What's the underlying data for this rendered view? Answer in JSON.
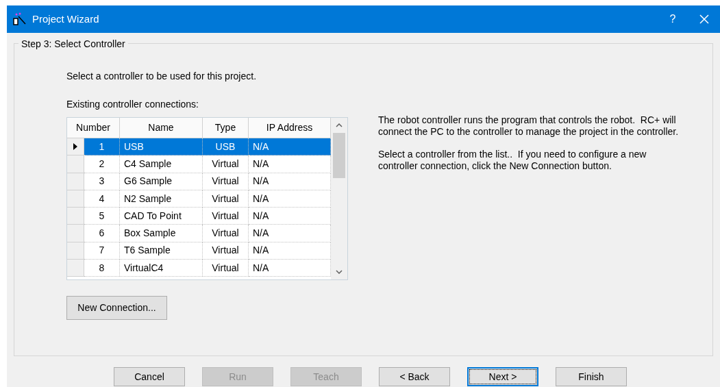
{
  "window": {
    "title": "Project Wizard",
    "help_glyph": "?"
  },
  "step": {
    "title": "Step 3: Select Controller"
  },
  "intro": "Select a controller to be used for this project.",
  "list_label": "Existing controller connections:",
  "table": {
    "columns": [
      "Number",
      "Name",
      "Type",
      "IP Address"
    ],
    "rows": [
      {
        "cells": [
          "1",
          "USB",
          "USB",
          "N/A"
        ],
        "selected": true
      },
      {
        "cells": [
          "2",
          "C4 Sample",
          "Virtual",
          "N/A"
        ],
        "selected": false
      },
      {
        "cells": [
          "3",
          "G6 Sample",
          "Virtual",
          "N/A"
        ],
        "selected": false
      },
      {
        "cells": [
          "4",
          "N2 Sample",
          "Virtual",
          "N/A"
        ],
        "selected": false
      },
      {
        "cells": [
          "5",
          "CAD To Point",
          "Virtual",
          "N/A"
        ],
        "selected": false
      },
      {
        "cells": [
          "6",
          "Box Sample",
          "Virtual",
          "N/A"
        ],
        "selected": false
      },
      {
        "cells": [
          "7",
          "T6 Sample",
          "Virtual",
          "N/A"
        ],
        "selected": false
      },
      {
        "cells": [
          "8",
          "VirtualC4",
          "Virtual",
          "N/A"
        ],
        "selected": false
      }
    ]
  },
  "new_connection": "New Connection...",
  "help": [
    "The robot controller runs the program that controls the robot.  RC+ will connect the PC to the controller to manage the project in the controller.",
    "Select a controller from the list..  If you need to configure a new controller connection, click the New Connection button."
  ],
  "buttons": [
    {
      "label": "Cancel",
      "disabled": false,
      "default": false
    },
    {
      "label": "Run",
      "disabled": true,
      "default": false
    },
    {
      "label": "Teach",
      "disabled": true,
      "default": false
    },
    {
      "label": "< Back",
      "disabled": false,
      "default": false
    },
    {
      "label": "Next >",
      "disabled": false,
      "default": true
    },
    {
      "label": "Finish",
      "disabled": false,
      "default": false
    }
  ]
}
